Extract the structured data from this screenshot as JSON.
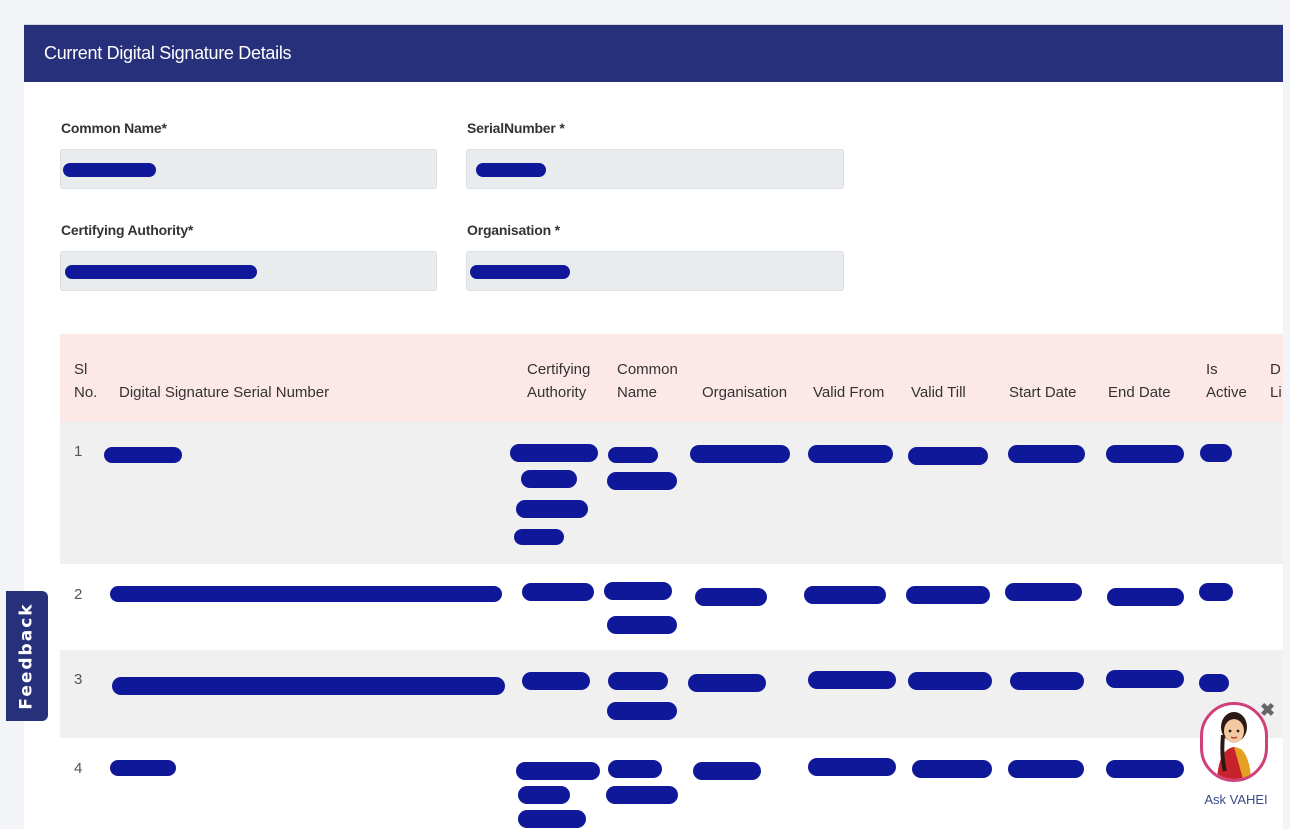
{
  "card": {
    "title": "Current Digital Signature Details"
  },
  "form": {
    "common_name_label": "Common Name*",
    "serial_number_label": "SerialNumber *",
    "certifying_authority_label": "Certifying Authority*",
    "organisation_label": "Organisation *"
  },
  "table": {
    "headers": {
      "sl_no_1": "Sl",
      "sl_no_2": "No.",
      "serial": "Digital Signature Serial Number",
      "ca_1": "Certifying",
      "ca_2": "Authority",
      "cn_1": "Common",
      "cn_2": "Name",
      "org": "Organisation",
      "valid_from": "Valid From",
      "valid_till": "Valid Till",
      "start_date": "Start Date",
      "end_date": "End Date",
      "active_1": "Is",
      "active_2": "Active",
      "dl_1": "D",
      "dl_2": "Li"
    },
    "rows": [
      {
        "num": "1"
      },
      {
        "num": "2"
      },
      {
        "num": "3"
      },
      {
        "num": "4"
      }
    ]
  },
  "feedback": {
    "label": "Feedback"
  },
  "assistant": {
    "label": "Ask VAHEI",
    "close": "✖"
  },
  "colors": {
    "header_bg": "#27307a",
    "table_header_bg": "#fde8e8",
    "redaction": "#10189a"
  }
}
